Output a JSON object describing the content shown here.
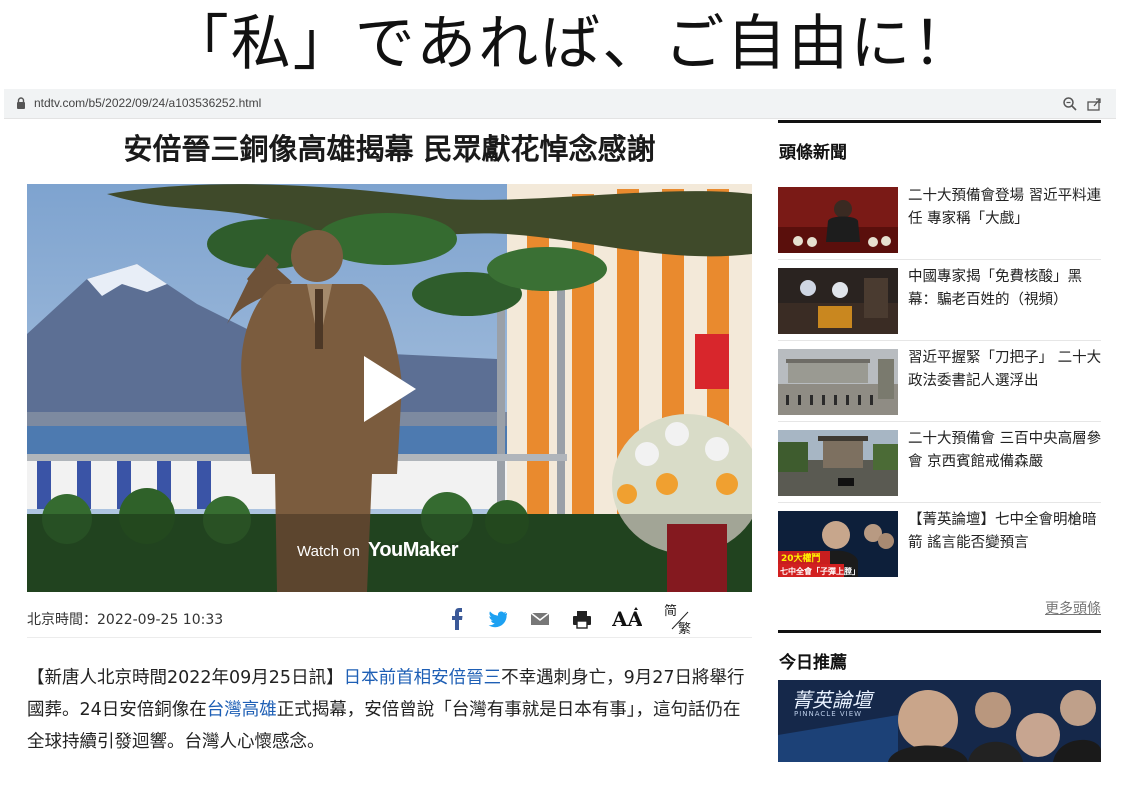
{
  "overlay_caption": "「私」であれば、ご自由に！",
  "browser": {
    "url": "ntdtv.com/b5/2022/09/24/a103536252.html"
  },
  "article": {
    "title": "安倍晉三銅像高雄揭幕 民眾獻花悼念感謝",
    "video": {
      "watch_on": "Watch on",
      "brand": "YouMaker"
    },
    "timestamp": "北京時間：2022-09-25 10:33",
    "share_icons": [
      "facebook-icon",
      "twitter-icon",
      "email-icon",
      "print-icon",
      "font-size-icon",
      "simplified-traditional-icon"
    ],
    "font_size_label": "AA",
    "simp_trad_label_top": "简",
    "simp_trad_label_bottom": "繁",
    "lead": {
      "part1": "【新唐人北京時間2022年09月25日訊】",
      "link1": "日本前首相安倍晉三",
      "part2": "不幸遇刺身亡，9月27日將舉行國葬。24日安倍銅像在",
      "link2": "台灣高雄",
      "part3": "正式揭幕，安倍曾說「台灣有事就是日本有事」，這句話仍在全球持續引發迴響。台灣人心懷感念。"
    },
    "link_color": "#1e5fb5"
  },
  "sidebar": {
    "headlines_title": "頭條新聞",
    "items": [
      {
        "text": "二十大預備會登場 習近平料連任 專家稱「大戲」"
      },
      {
        "text": "中國專家揭「免費核酸」黑幕：騙老百姓的（視頻）"
      },
      {
        "text": "習近平握緊「刀把子」 二十大政法委書記人選浮出"
      },
      {
        "text": "二十大預備會 三百中央高層參會 京西賓館戒備森嚴"
      },
      {
        "text": "【菁英論壇】七中全會明槍暗箭 謠言能否變預言",
        "thumb_caption_1": "20大權鬥",
        "thumb_caption_2": "七中全會「子彈上膛」"
      }
    ],
    "more_label": "更多頭條",
    "recommend_title": "今日推薦",
    "recommend_banner_title": "菁英論壇",
    "recommend_banner_sub": "PINNACLE VIEW"
  }
}
